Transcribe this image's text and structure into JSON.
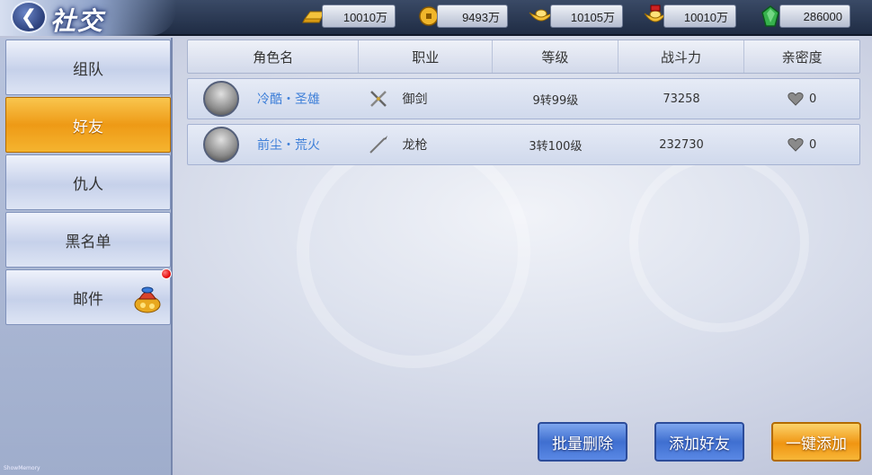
{
  "title": "社交",
  "currencies": [
    {
      "icon": "gold-bar-icon",
      "value": "10010万"
    },
    {
      "icon": "copper-coin-icon",
      "value": "9493万"
    },
    {
      "icon": "silver-ingot-icon",
      "value": "10105万"
    },
    {
      "icon": "gold-ingot-icon",
      "value": "10010万"
    },
    {
      "icon": "jade-icon",
      "value": "286000"
    }
  ],
  "sidebar": {
    "items": [
      {
        "label": "组队",
        "active": false
      },
      {
        "label": "好友",
        "active": true
      },
      {
        "label": "仇人",
        "active": false
      },
      {
        "label": "黑名单",
        "active": false
      },
      {
        "label": "邮件",
        "active": false,
        "badge": true
      }
    ]
  },
  "table": {
    "headers": [
      "角色名",
      "职业",
      "等级",
      "战斗力",
      "亲密度"
    ],
    "rows": [
      {
        "name": "冷酷・圣雄",
        "job": "御剑",
        "job_icon": "crossed-swords-icon",
        "level": "9转99级",
        "power": "73258",
        "intimacy": "0"
      },
      {
        "name": "前尘・荒火",
        "job": "龙枪",
        "job_icon": "spear-icon",
        "level": "3转100级",
        "power": "232730",
        "intimacy": "0"
      }
    ]
  },
  "buttons": {
    "batch_delete": "批量删除",
    "add_friend": "添加好友",
    "one_click_add": "一键添加"
  },
  "watermark": "ShowMemory"
}
